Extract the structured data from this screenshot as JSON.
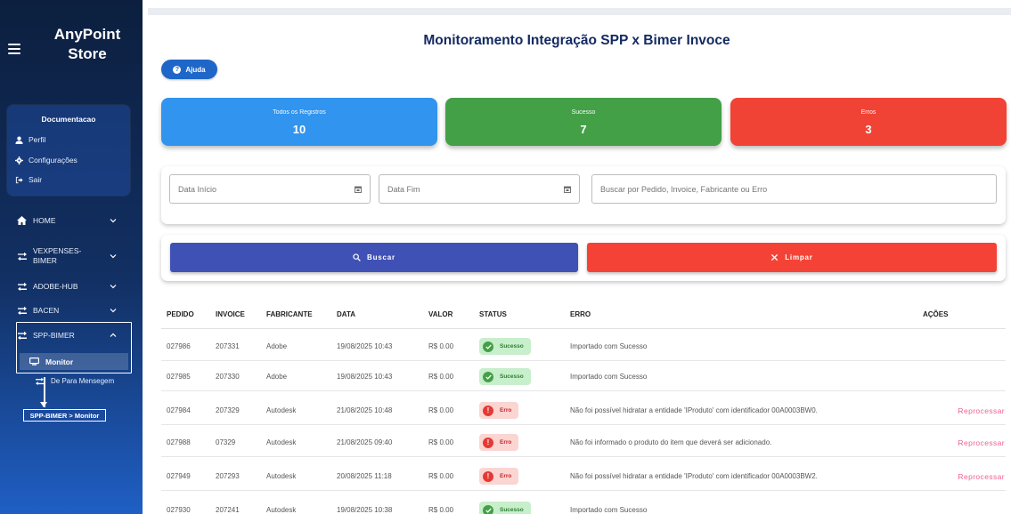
{
  "sidebar": {
    "brand_line1": "AnyPoint",
    "brand_line2": "Store",
    "user": {
      "name": "Documentacao",
      "links": [
        "Perfil",
        "Configurações",
        "Sair"
      ]
    },
    "nav": {
      "home": "HOME",
      "vexpenses_line1": "VEXPENSES-",
      "vexpenses_line2": "BIMER",
      "adobe_hub": "ADOBE-HUB",
      "bacen": "BACEN",
      "spp_bimer": "SPP-BIMER",
      "monitor": "Monitor",
      "de_para": "De Para Mensegem"
    },
    "breadcrumb_tooltip": "SPP-BIMER > Monitor"
  },
  "header": {
    "title": "Monitoramento Integração SPP x Bimer Invoce",
    "help_label": "Ajuda"
  },
  "stats": {
    "all": {
      "label": "Todos os Registros",
      "value": "10"
    },
    "success": {
      "label": "Sucesso",
      "value": "7"
    },
    "errors": {
      "label": "Erros",
      "value": "3"
    }
  },
  "filters": {
    "start_date_placeholder": "Data Início",
    "end_date_placeholder": "Data Fim",
    "search_placeholder": "Buscar por Pedido, Invoice, Fabricante ou Erro"
  },
  "actions": {
    "search_label": "Buscar",
    "clear_label": "Limpar"
  },
  "table": {
    "columns": {
      "pedido": "PEDIDO",
      "invoice": "INVOICE",
      "fabricante": "FABRICANTE",
      "data": "DATA",
      "valor": "VALOR",
      "status": "STATUS",
      "erro": "ERRO",
      "acoes": "AÇÕES"
    },
    "rows": [
      {
        "pedido": "027986",
        "invoice": "207331",
        "fabricante": "Adobe",
        "data": "19/08/2025 10:43",
        "valor": "R$ 0.00",
        "status": "Sucesso",
        "erro": "Importado com Sucesso",
        "acao": ""
      },
      {
        "pedido": "027985",
        "invoice": "207330",
        "fabricante": "Adobe",
        "data": "19/08/2025 10:43",
        "valor": "R$ 0.00",
        "status": "Sucesso",
        "erro": "Importado com Sucesso",
        "acao": ""
      },
      {
        "pedido": "027984",
        "invoice": "207329",
        "fabricante": "Autodesk",
        "data": "21/08/2025 10:48",
        "valor": "R$ 0.00",
        "status": "Erro",
        "erro": "Não foi possível hidratar a entidade 'IProduto' com identificador 00A0003BW0.",
        "acao": "Reprocessar"
      },
      {
        "pedido": "027988",
        "invoice": "07329",
        "fabricante": "Autodesk",
        "data": "21/08/2025 09:40",
        "valor": "R$ 0.00",
        "status": "Erro",
        "erro": "Não foi informado o produto do item que deverá ser adicionado.",
        "acao": "Reprocessar"
      },
      {
        "pedido": "027949",
        "invoice": "207293",
        "fabricante": "Autodesk",
        "data": "20/08/2025 11:18",
        "valor": "R$ 0.00",
        "status": "Erro",
        "erro": "Não foi possível hidratar a entidade 'IProduto' com identificador 00A0003BW2.",
        "acao": "Reprocessar"
      },
      {
        "pedido": "027930",
        "invoice": "207241",
        "fabricante": "Autodesk",
        "data": "19/08/2025 10:38",
        "valor": "R$ 0.00",
        "status": "Sucesso",
        "erro": "Importado com Sucesso",
        "acao": ""
      }
    ]
  },
  "colors": {
    "sidebar_top": "#0c1f3e",
    "sidebar_bottom": "#1f5fc4",
    "title": "#142a62",
    "stat_all": "#3194ee",
    "stat_success": "#43a047",
    "stat_error": "#f14335",
    "search_button": "#3f51b5",
    "clear_button": "#f44336",
    "reprocess_link": "#f06292"
  }
}
